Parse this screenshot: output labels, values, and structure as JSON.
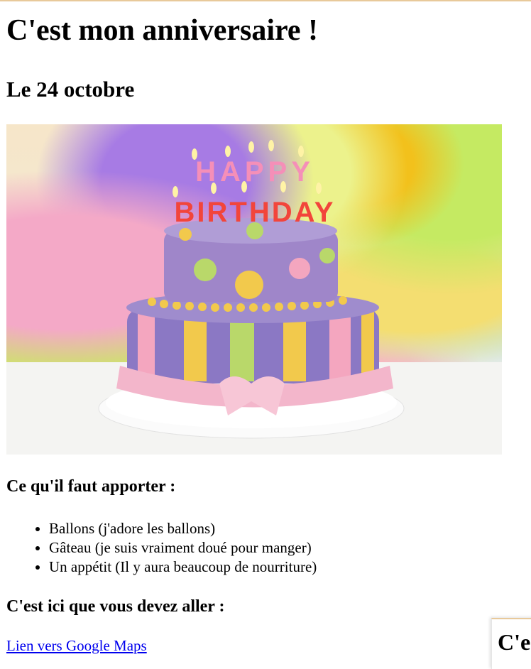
{
  "page": {
    "title": "C'est mon anniversaire !",
    "date_heading": "Le 24 octobre",
    "image_alt": "Gâteau d'anniversaire Happy Birthday",
    "cake_text_top": "HAPPY",
    "cake_text_bottom": "BIRTHDAY",
    "bring_heading": "Ce qu'il faut apporter :",
    "bring_items": [
      "Ballons (j'adore les ballons)",
      "Gâteau (je suis vraiment doué pour manger)",
      "Un appétit (Il y aura beaucoup de nourriture)"
    ],
    "go_heading": "C'est ici que vous devez aller :",
    "maps_link": "Lien vers Google Maps",
    "floating_card_text": "C'est mon anniversaire !"
  },
  "colors": {
    "link": "#0000ee",
    "top_border": "#e8c99a",
    "cake_top": "#9f86c9",
    "cake_bottom": "#8b78c4",
    "ribbon": "#f3b6cb",
    "stripe_yellow": "#f2c94c",
    "stripe_green": "#b9d86a",
    "stripe_pink": "#f4a6bf"
  }
}
